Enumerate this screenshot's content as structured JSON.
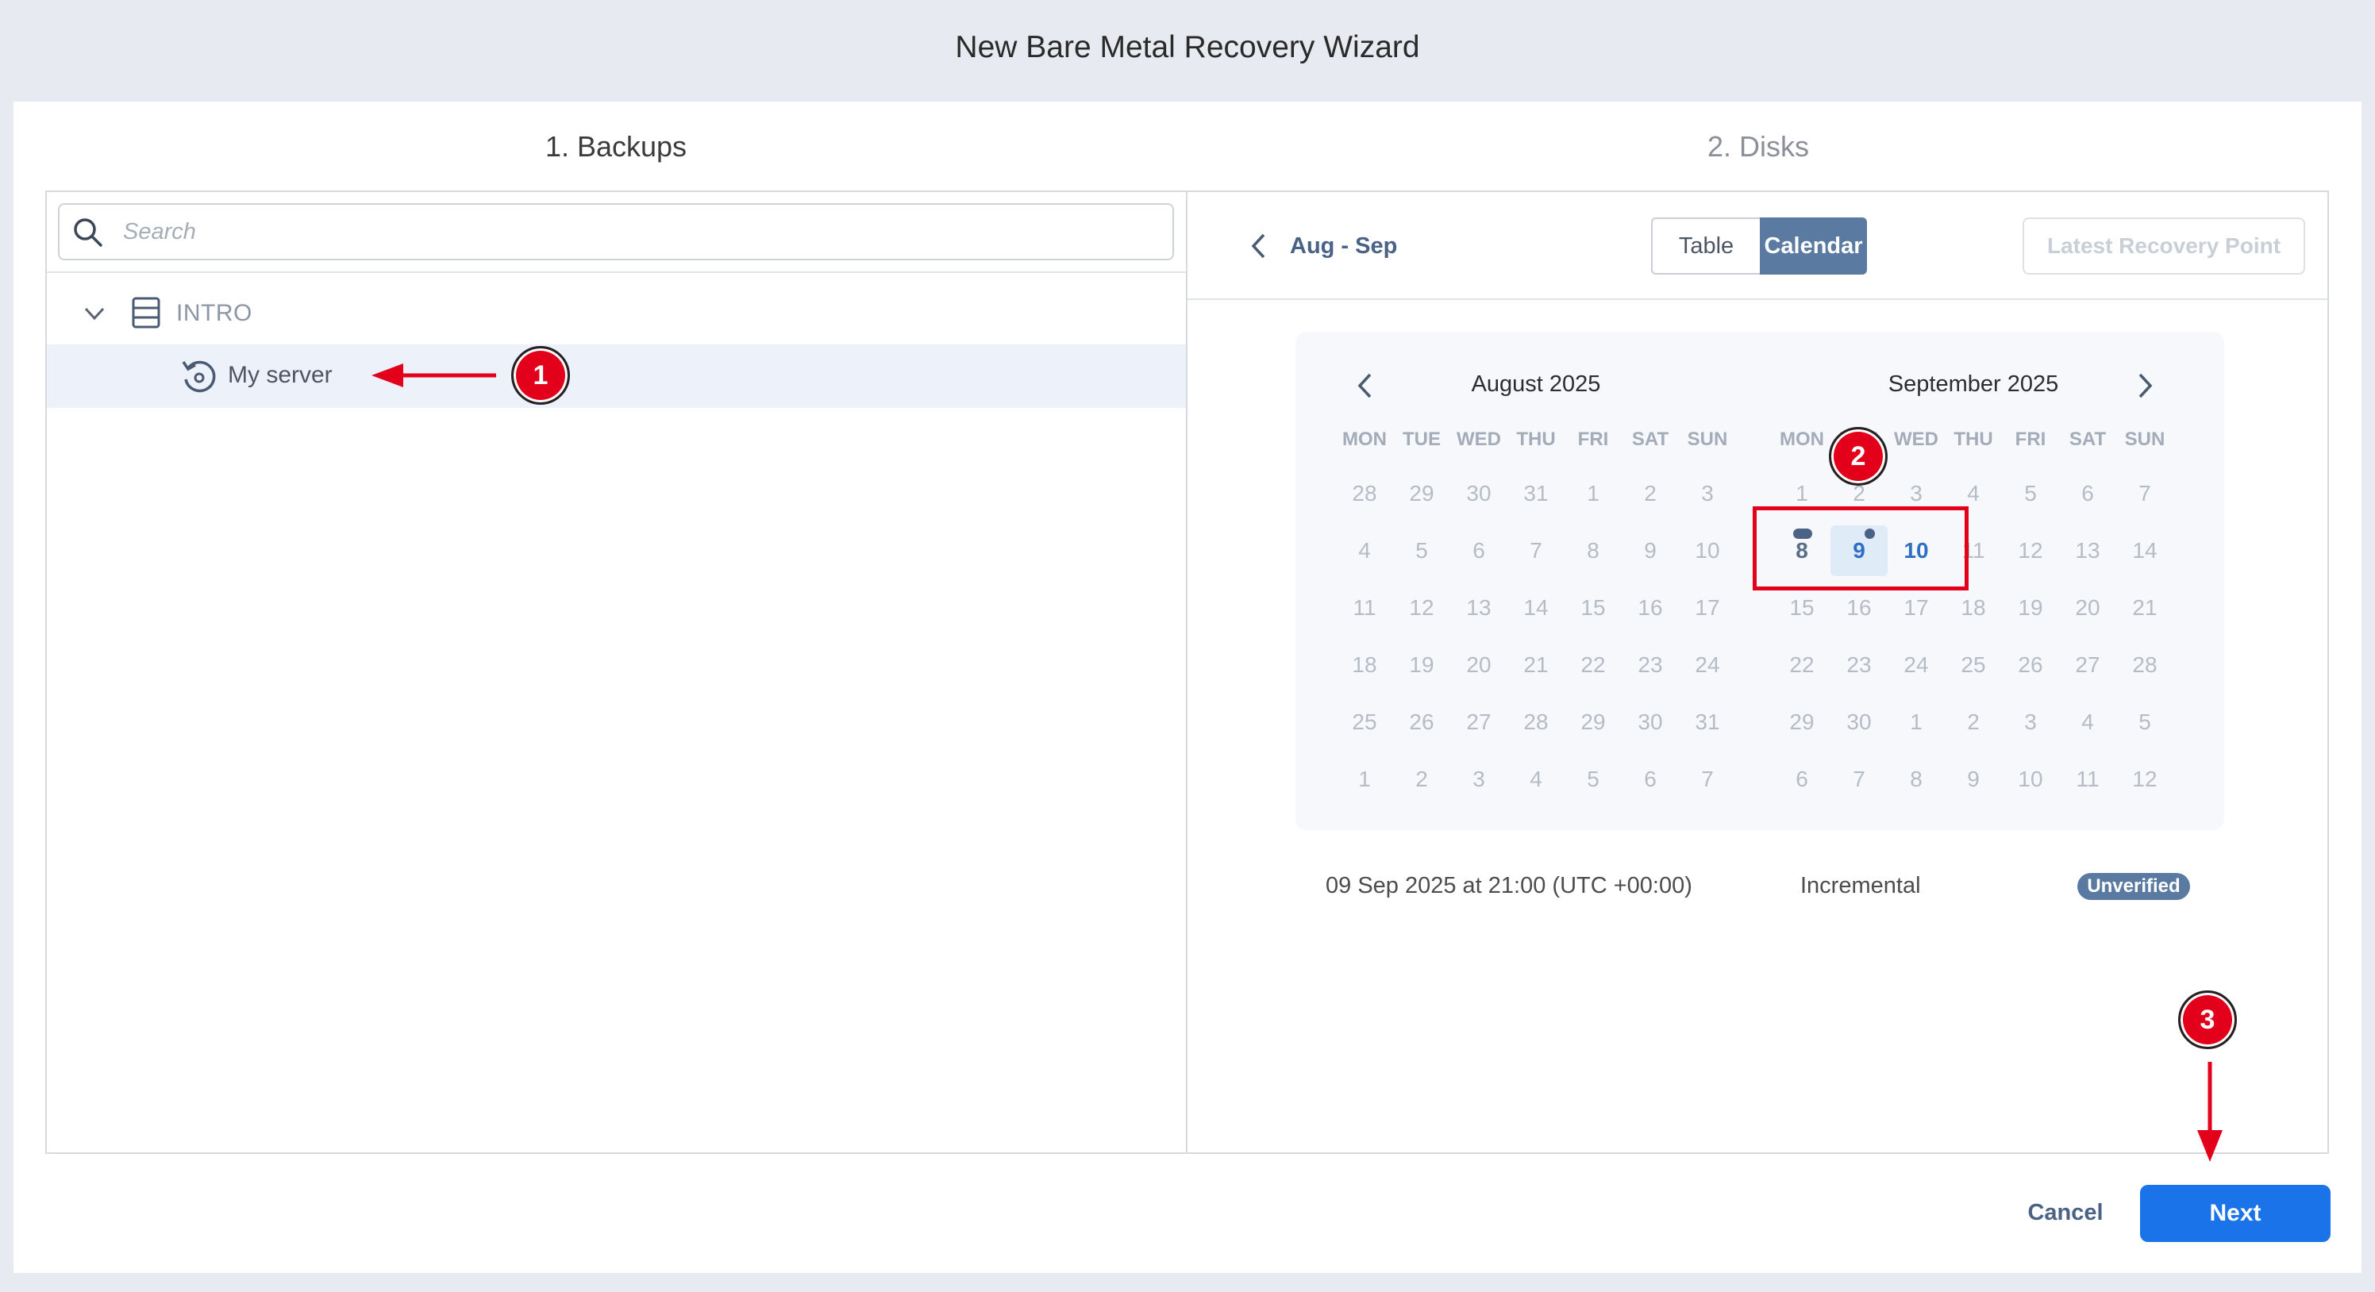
{
  "wizard": {
    "title": "New Bare Metal Recovery Wizard",
    "steps": [
      {
        "label": "1. Backups",
        "state": "active"
      },
      {
        "label": "2. Disks",
        "state": "inactive"
      }
    ]
  },
  "left_panel": {
    "search": {
      "placeholder": "Search",
      "value": ""
    },
    "tree": {
      "group": {
        "label": "INTRO",
        "icon": "server-rack-icon",
        "expanded": true
      },
      "item": {
        "label": "My server",
        "icon": "restore-icon",
        "selected": true
      }
    }
  },
  "right_panel": {
    "range_label": "Aug - Sep",
    "view_toggle": {
      "table": "Table",
      "calendar": "Calendar",
      "active": "calendar"
    },
    "latest_recovery_point": "Latest Recovery Point",
    "weekdays": [
      "MON",
      "TUE",
      "WED",
      "THU",
      "FRI",
      "SAT",
      "SUN"
    ],
    "months": [
      {
        "title": "August 2025",
        "weeks": [
          [
            "28",
            "29",
            "30",
            "31",
            "1",
            "2",
            "3"
          ],
          [
            "4",
            "5",
            "6",
            "7",
            "8",
            "9",
            "10"
          ],
          [
            "11",
            "12",
            "13",
            "14",
            "15",
            "16",
            "17"
          ],
          [
            "18",
            "19",
            "20",
            "21",
            "22",
            "23",
            "24"
          ],
          [
            "25",
            "26",
            "27",
            "28",
            "29",
            "30",
            "31"
          ],
          [
            "1",
            "2",
            "3",
            "4",
            "5",
            "6",
            "7"
          ]
        ]
      },
      {
        "title": "September 2025",
        "weeks": [
          [
            "1",
            "2",
            "3",
            "4",
            "5",
            "6",
            "7"
          ],
          [
            "8",
            "9",
            "10",
            "11",
            "12",
            "13",
            "14"
          ],
          [
            "15",
            "16",
            "17",
            "18",
            "19",
            "20",
            "21"
          ],
          [
            "22",
            "23",
            "24",
            "25",
            "26",
            "27",
            "28"
          ],
          [
            "29",
            "30",
            "1",
            "2",
            "3",
            "4",
            "5"
          ],
          [
            "6",
            "7",
            "8",
            "9",
            "10",
            "11",
            "12"
          ]
        ]
      }
    ],
    "selected_date": "9",
    "recovery_point": {
      "date": "09 Sep 2025 at 21:00 (UTC +00:00)",
      "type": "Incremental",
      "status": "Unverified"
    }
  },
  "footer": {
    "cancel": "Cancel",
    "next": "Next"
  },
  "annotations": {
    "callout_1": "1",
    "callout_2": "2",
    "callout_3": "3"
  },
  "colors": {
    "accent": "#1a73e8",
    "toggle_active": "#5a7aa1",
    "annotation": "#e3001b"
  }
}
